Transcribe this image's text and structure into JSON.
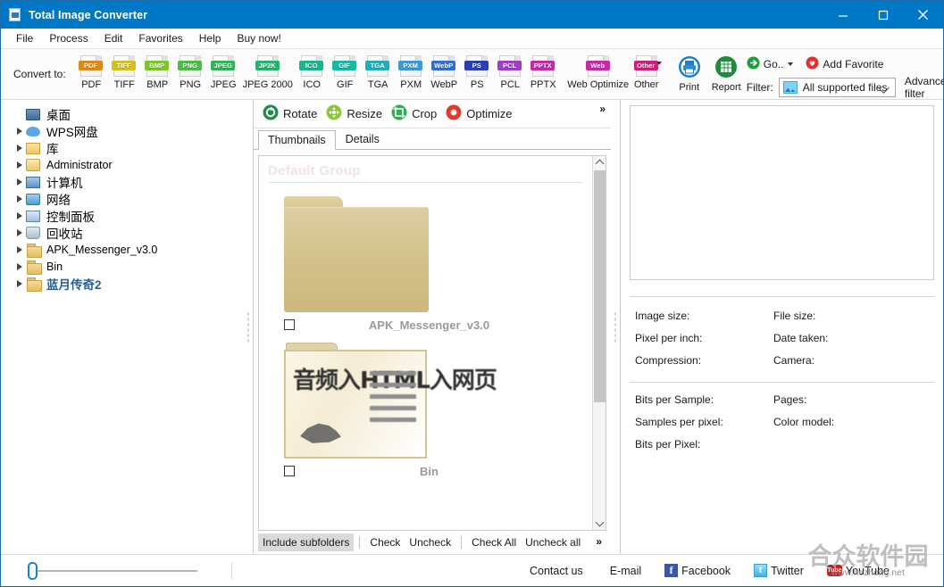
{
  "window": {
    "title": "Total Image Converter",
    "app_icon": "image-file-icon",
    "minimize": "minimize-icon",
    "maximize": "maximize-icon",
    "close": "close-icon",
    "titlebar_color": "#0078c8"
  },
  "menu": {
    "items": [
      {
        "label": "File"
      },
      {
        "label": "Process"
      },
      {
        "label": "Edit"
      },
      {
        "label": "Favorites"
      },
      {
        "label": "Help"
      },
      {
        "label": "Buy now!"
      }
    ]
  },
  "toolbar": {
    "convert_to_label": "Convert to:",
    "formats": [
      {
        "label": "PDF",
        "tag": "PDF",
        "color": "#d98a1b"
      },
      {
        "label": "TIFF",
        "tag": "TIFF",
        "color": "#d4c020"
      },
      {
        "label": "BMP",
        "tag": "BMP",
        "color": "#7ec42c"
      },
      {
        "label": "PNG",
        "tag": "PNG",
        "color": "#4fb94a"
      },
      {
        "label": "JPEG",
        "tag": "JPEG",
        "color": "#33b35c"
      },
      {
        "label": "JPEG 2000",
        "tag": "JP2K",
        "color": "#23b36f"
      },
      {
        "label": "ICO",
        "tag": "ICO",
        "color": "#1bb58c"
      },
      {
        "label": "GIF",
        "tag": "GIF",
        "color": "#19b8a2"
      },
      {
        "label": "TGA",
        "tag": "TGA",
        "color": "#21aebb"
      },
      {
        "label": "PXM",
        "tag": "PXM",
        "color": "#3b9ad6"
      },
      {
        "label": "WebP",
        "tag": "WebP",
        "color": "#2f6fd0"
      },
      {
        "label": "PS",
        "tag": "PS",
        "color": "#2b3fae"
      },
      {
        "label": "PCL",
        "tag": "PCL",
        "color": "#9d3fc0"
      },
      {
        "label": "PPTX",
        "tag": "PPTX",
        "color": "#c32aa6"
      },
      {
        "label": "Web Optimize",
        "tag": "Web",
        "color": "#c52ba4"
      },
      {
        "label": "Other",
        "tag": "Other",
        "color": "#cf1f7a"
      }
    ],
    "print_label": "Print",
    "print_icon": "printer-icon",
    "report_label": "Report",
    "report_icon": "report-grid-icon",
    "go_label": "Go..",
    "go_icon": "green-arrow-icon",
    "add_favorite_label": "Add Favorite",
    "add_favorite_icon": "red-heart-icon",
    "filter_label": "Filter:",
    "filter_value": "All supported files",
    "filter_icon": "picture-icon",
    "advanced_filter_label": "Advanced filter"
  },
  "sidebar": {
    "items": [
      {
        "label": "桌面",
        "icon": "desktop-icon",
        "expandable": false,
        "style": "cn"
      },
      {
        "label": "WPS网盘",
        "icon": "cloud-icon",
        "expandable": true,
        "style": "cn"
      },
      {
        "label": "库",
        "icon": "library-icon",
        "expandable": true,
        "style": "cn"
      },
      {
        "label": "Administrator",
        "icon": "user-folder-icon",
        "expandable": true,
        "style": "en"
      },
      {
        "label": "计算机",
        "icon": "computer-icon",
        "expandable": true,
        "style": "cn"
      },
      {
        "label": "网络",
        "icon": "network-icon",
        "expandable": true,
        "style": "cn"
      },
      {
        "label": "控制面板",
        "icon": "control-panel-icon",
        "expandable": true,
        "style": "cn"
      },
      {
        "label": "回收站",
        "icon": "recycle-bin-icon",
        "expandable": true,
        "style": "cn"
      },
      {
        "label": "APK_Messenger_v3.0",
        "icon": "folder-icon",
        "expandable": true,
        "style": "en"
      },
      {
        "label": "Bin",
        "icon": "folder-icon",
        "expandable": true,
        "style": "en"
      },
      {
        "label": "蓝月传奇2",
        "icon": "folder-icon",
        "expandable": true,
        "style": "cn-blue"
      }
    ]
  },
  "center": {
    "operations": [
      {
        "label": "Rotate",
        "icon": "rotate-icon",
        "color": "#1e8c4a"
      },
      {
        "label": "Resize",
        "icon": "resize-icon",
        "color": "#8cc63f"
      },
      {
        "label": "Crop",
        "icon": "crop-icon",
        "color": "#2fae4e"
      },
      {
        "label": "Optimize",
        "icon": "optimize-icon",
        "color": "#e23a2e"
      }
    ],
    "more_icon": "chevron-double-right-icon",
    "tabs": [
      {
        "label": "Thumbnails",
        "active": true
      },
      {
        "label": "Details",
        "active": false
      }
    ],
    "group_title": "Default Group",
    "thumbnails": [
      {
        "name": "APK_Messenger_v3.0",
        "kind": "plain-folder",
        "checked": false
      },
      {
        "name": "Bin",
        "kind": "document-folder",
        "checked": false
      }
    ],
    "thumb_doc_text": "音频入HTML入网页",
    "bottom_actions": [
      {
        "label": "Include subfolders",
        "selected": true
      },
      {
        "label": "Check",
        "selected": false
      },
      {
        "label": "Uncheck",
        "selected": false
      },
      {
        "label": "Check All",
        "selected": false
      },
      {
        "label": "Uncheck all",
        "selected": false
      }
    ],
    "bottom_more_icon": "chevron-double-right-icon"
  },
  "properties": {
    "group1_left": [
      {
        "label": "Image size:"
      },
      {
        "label": "Pixel per inch:"
      },
      {
        "label": "Compression:"
      }
    ],
    "group1_right": [
      {
        "label": "File size:"
      },
      {
        "label": "Date taken:"
      },
      {
        "label": "Camera:"
      }
    ],
    "group2_left": [
      {
        "label": "Bits per Sample:"
      },
      {
        "label": "Samples per pixel:"
      },
      {
        "label": "Bits per Pixel:"
      }
    ],
    "group2_right": [
      {
        "label": "Pages:"
      },
      {
        "label": "Color model:"
      }
    ]
  },
  "status": {
    "zoom_value": "0",
    "contact_us": "Contact us",
    "email": "E-mail",
    "facebook": "Facebook",
    "facebook_glyph": "f",
    "twitter": "Twitter",
    "twitter_glyph": "t",
    "youtube": "YouTube",
    "youtube_glyph": "Tube"
  },
  "watermark": {
    "text": "合众软件园",
    "url": "www.hezhong.net"
  }
}
